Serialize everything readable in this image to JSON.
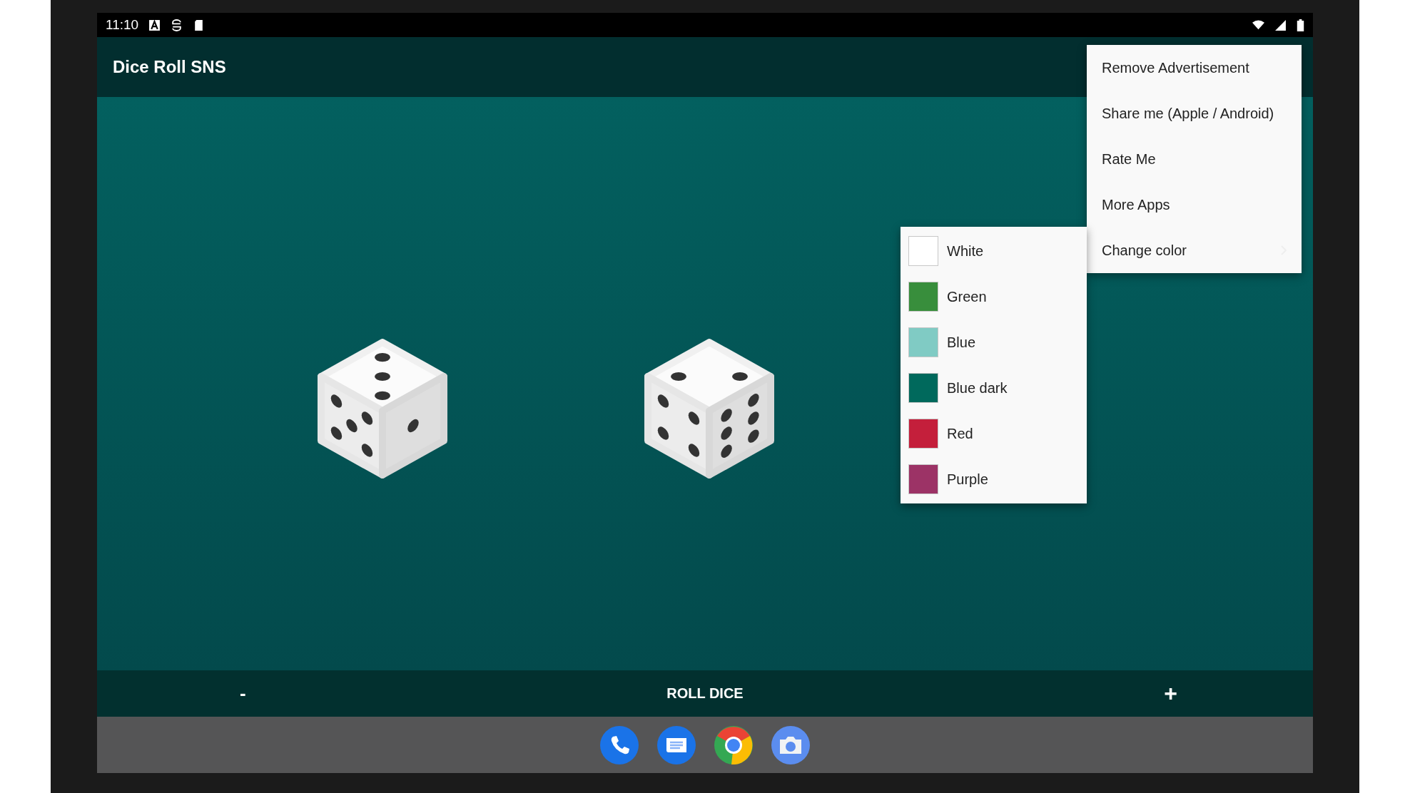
{
  "status_bar": {
    "time": "11:10"
  },
  "app_bar": {
    "title": "Dice Roll SNS"
  },
  "overflow_menu": {
    "items": [
      {
        "label": "Remove Advertisement",
        "kind": "action"
      },
      {
        "label": "Share me (Apple / Android)",
        "kind": "action"
      },
      {
        "label": "Rate Me",
        "kind": "action"
      },
      {
        "label": "More Apps",
        "kind": "action"
      },
      {
        "label": "Change color",
        "kind": "submenu"
      }
    ]
  },
  "color_submenu": {
    "items": [
      {
        "label": "White",
        "color": "#ffffff"
      },
      {
        "label": "Green",
        "color": "#388e3c"
      },
      {
        "label": "Blue",
        "color": "#80cbc4"
      },
      {
        "label": "Blue dark",
        "color": "#00695c"
      },
      {
        "label": "Red",
        "color": "#c41f3b"
      },
      {
        "label": "Purple",
        "color": "#9c3366"
      }
    ]
  },
  "bottom_bar": {
    "minus": "-",
    "roll_button": "ROLL DICE",
    "plus": "+"
  }
}
